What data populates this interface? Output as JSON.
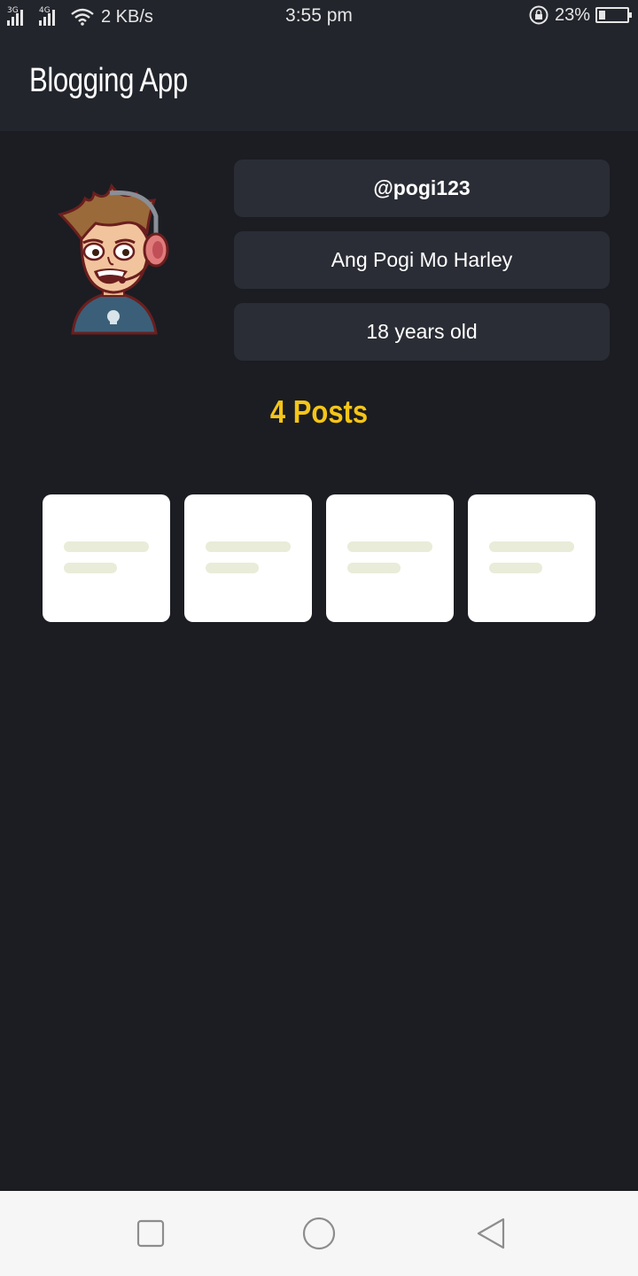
{
  "status_bar": {
    "sim1_tag": "3G",
    "sim2_tag": "4G",
    "net_speed": "2 KB/s",
    "time": "3:55 pm",
    "battery_percent": "23%",
    "battery_level": 0.23
  },
  "app_bar": {
    "title": "Blogging App"
  },
  "profile": {
    "username": "@pogi123",
    "full_name": "Ang Pogi Mo Harley",
    "age": "18 years old",
    "avatar_icon": "cartoon-avatar-with-headset"
  },
  "posts": {
    "count_label": "4 Posts",
    "items": [
      {
        "icon": "post-placeholder-icon"
      },
      {
        "icon": "post-placeholder-icon"
      },
      {
        "icon": "post-placeholder-icon"
      },
      {
        "icon": "post-placeholder-icon"
      }
    ]
  },
  "nav_bar": {
    "recent_icon": "square-icon",
    "home_icon": "circle-icon",
    "back_icon": "triangle-back-icon"
  },
  "colors": {
    "background": "#1b1d22",
    "app_bar": "#22252c",
    "info_box": "#2a2d35",
    "accent": "#f5c518"
  }
}
